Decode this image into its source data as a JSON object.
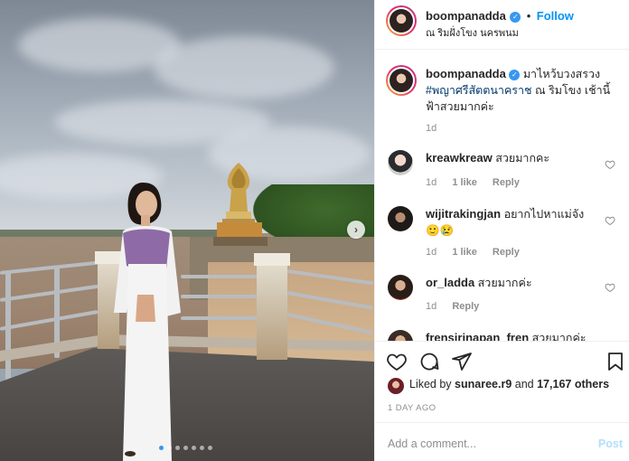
{
  "post": {
    "username": "boompanadda",
    "follow_label": "Follow",
    "location": "ณ ริมฝั่งโขง นครพนม",
    "caption_lead": "มาไหว้บวงสรวง",
    "caption_hashtag": "#พญาศรีสัตตนาคราช",
    "caption_rest": "ณ ริมโขง เช้านี้ ฟ้าสวยมากค่ะ",
    "caption_time": "1d"
  },
  "comments": [
    {
      "user": "kreawkreaw",
      "text": "สวยมากคะ",
      "time": "1d",
      "likes": "1 like",
      "reply": "Reply"
    },
    {
      "user": "wijitrakingjan",
      "text": "อยากไปหาแม่จัง🙂😢",
      "time": "1d",
      "likes": "1 like",
      "reply": "Reply"
    },
    {
      "user": "or_ladda",
      "text": "สวยมากค่ะ",
      "time": "1d",
      "reply": "Reply"
    },
    {
      "user": "frensirinapan_fren",
      "text": "สวยมากค่ะคุณ"
    }
  ],
  "likes": {
    "liked_by_label": "Liked by",
    "liked_user": "sunaree.r9",
    "and_label": "and",
    "others": "17,167 others"
  },
  "date": "1 DAY AGO",
  "comment_box": {
    "placeholder": "Add a comment...",
    "post_label": "Post"
  },
  "carousel": {
    "count": 7,
    "active_index": 0
  },
  "colors": {
    "follow": "#0095f6",
    "verified": "#3897f0",
    "muted": "#8e8e8e",
    "hashtag": "#00376b"
  },
  "icons": [
    "verified-badge-icon",
    "heart-icon",
    "comment-icon",
    "share-icon",
    "bookmark-icon",
    "chevron-right-icon"
  ]
}
